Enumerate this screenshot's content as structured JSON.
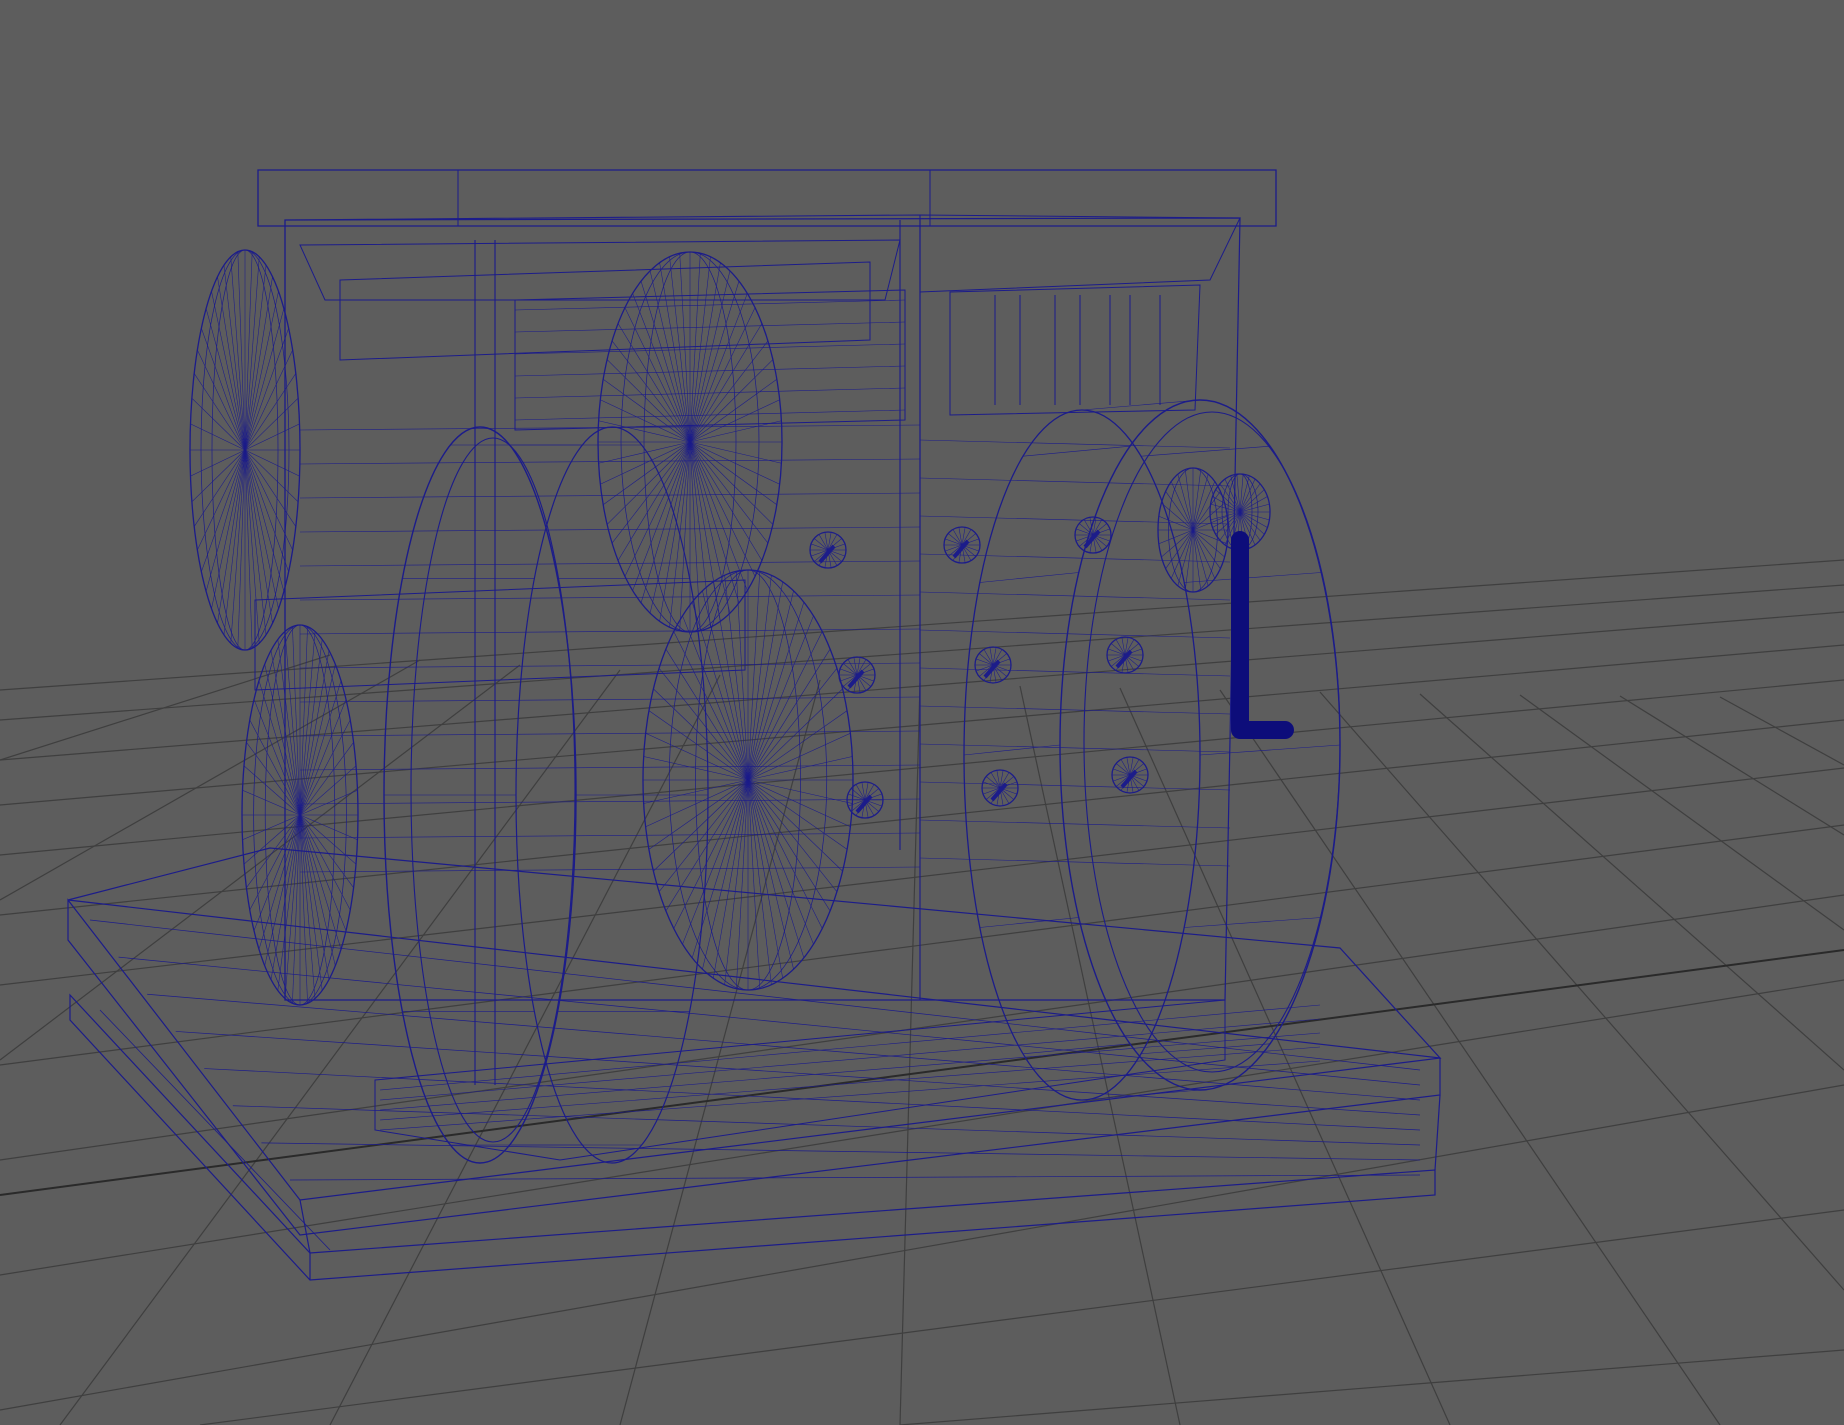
{
  "viewport": {
    "name": "perspective-viewport",
    "display_mode": "wireframe",
    "background_color": "#5d5d5d",
    "grid_color": "#3f3f3f",
    "grid_axis_color": "#2a2a2a",
    "wireframe_color": "#1c1c8a",
    "selected_color": "#0d0d7a"
  },
  "scene": {
    "model": "crank-machine-wireframe",
    "grid_visible": true
  }
}
